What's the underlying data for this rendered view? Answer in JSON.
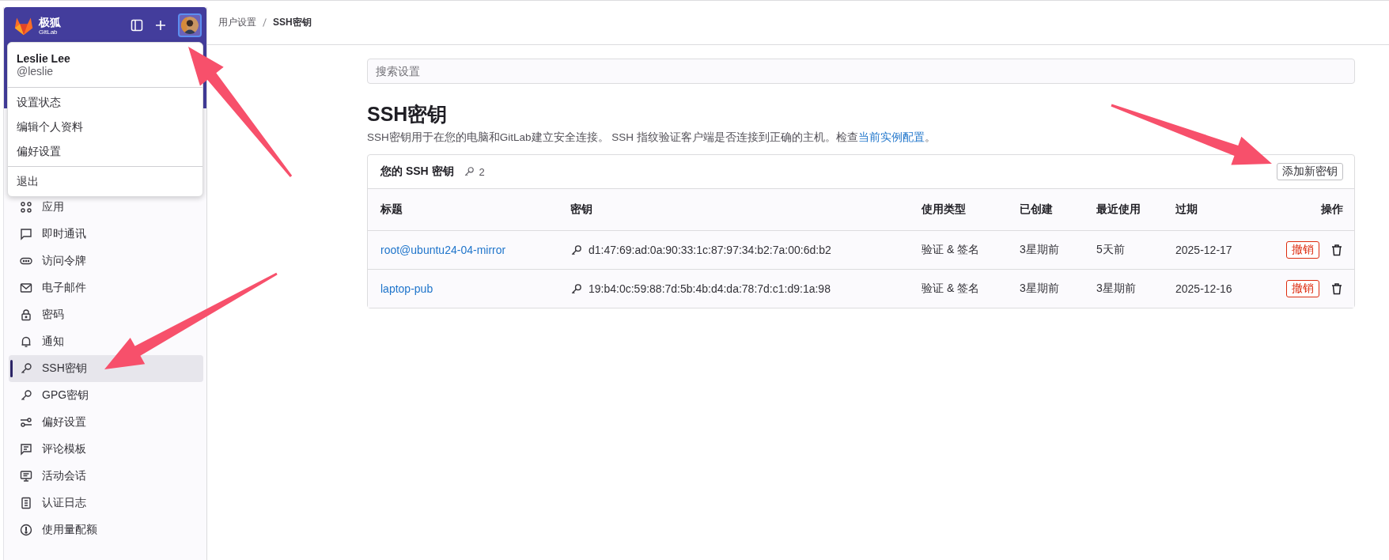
{
  "sidebar": {
    "brand": {
      "name": "极狐",
      "sub": "GitLab"
    },
    "items": [
      {
        "label": "应用",
        "selected": false
      },
      {
        "label": "即时通讯",
        "selected": false
      },
      {
        "label": "访问令牌",
        "selected": false
      },
      {
        "label": "电子邮件",
        "selected": false
      },
      {
        "label": "密码",
        "selected": false
      },
      {
        "label": "通知",
        "selected": false
      },
      {
        "label": "SSH密钥",
        "selected": true
      },
      {
        "label": "GPG密钥",
        "selected": false
      },
      {
        "label": "偏好设置",
        "selected": false
      },
      {
        "label": "评论模板",
        "selected": false
      },
      {
        "label": "活动会话",
        "selected": false
      },
      {
        "label": "认证日志",
        "selected": false
      },
      {
        "label": "使用量配额",
        "selected": false
      }
    ]
  },
  "user_menu": {
    "name": "Leslie Lee",
    "username": "@leslie",
    "sections": [
      {
        "items": [
          "设置状态",
          "编辑个人资料",
          "偏好设置"
        ]
      },
      {
        "items": [
          "退出"
        ]
      }
    ]
  },
  "breadcrumb": [
    "用户设置",
    "SSH密钥"
  ],
  "search": {
    "placeholder": "搜索设置"
  },
  "page": {
    "title": "SSH密钥",
    "description": "SSH密钥用于在您的电脑和GitLab建立安全连接。 SSH 指纹验证客户端是否连接到正确的主机。检查",
    "link": "当前实例配置",
    "description_end": "。"
  },
  "keys_card": {
    "title": "您的 SSH 密钥",
    "count": "2",
    "add_button": "添加新密钥",
    "columns": [
      "标题",
      "密钥",
      "使用类型",
      "已创建",
      "最近使用",
      "过期",
      "操作"
    ],
    "rows": [
      {
        "title": "root@ubuntu24-04-mirror",
        "fingerprint": "d1:47:69:ad:0a:90:33:1c:87:97:34:b2:7a:00:6d:b2",
        "usage": "验证 & 签名",
        "created": "3星期前",
        "last_used": "5天前",
        "expires": "2025-12-17",
        "revoke": "撤销"
      },
      {
        "title": "laptop-pub",
        "fingerprint": "19:b4:0c:59:88:7d:5b:4b:d4:da:78:7d:c1:d9:1a:98",
        "usage": "验证 & 签名",
        "created": "3星期前",
        "last_used": "3星期前",
        "expires": "2025-12-16",
        "revoke": "撤销"
      }
    ]
  }
}
